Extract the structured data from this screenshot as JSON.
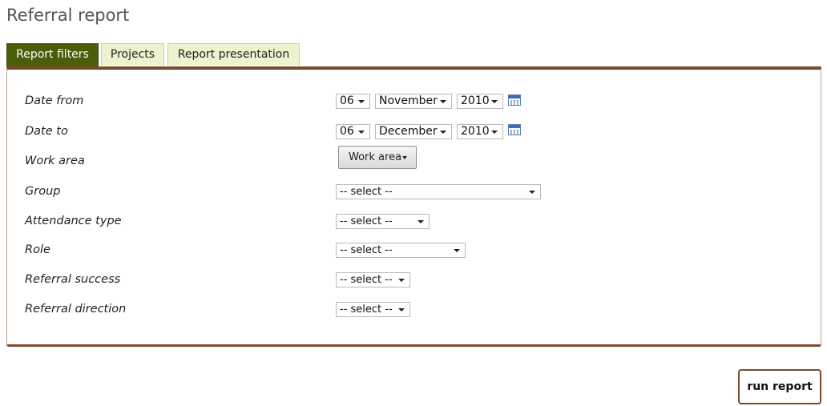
{
  "page": {
    "title": "Referral report"
  },
  "tabs": [
    {
      "label": "Report filters",
      "active": true
    },
    {
      "label": "Projects",
      "active": false
    },
    {
      "label": "Report presentation",
      "active": false
    }
  ],
  "filters": {
    "date_from": {
      "label": "Date from",
      "day": "06",
      "month": "November",
      "year": "2010",
      "icon": "calendar-icon"
    },
    "date_to": {
      "label": "Date to",
      "day": "06",
      "month": "December",
      "year": "2010",
      "icon": "calendar-icon"
    },
    "work_area": {
      "label": "Work area",
      "button_label": "Work area"
    },
    "group": {
      "label": "Group",
      "value": "-- select --"
    },
    "attendance_type": {
      "label": "Attendance type",
      "value": "-- select --"
    },
    "role": {
      "label": "Role",
      "value": "-- select --"
    },
    "referral_success": {
      "label": "Referral success",
      "value": "-- select --"
    },
    "referral_direction": {
      "label": "Referral direction",
      "value": "-- select --"
    }
  },
  "actions": {
    "run_label": "run report"
  },
  "colors": {
    "tab_active": "#4a5e0a",
    "tab_inactive": "#eef2cf",
    "panel_border": "#7b4a2a"
  }
}
